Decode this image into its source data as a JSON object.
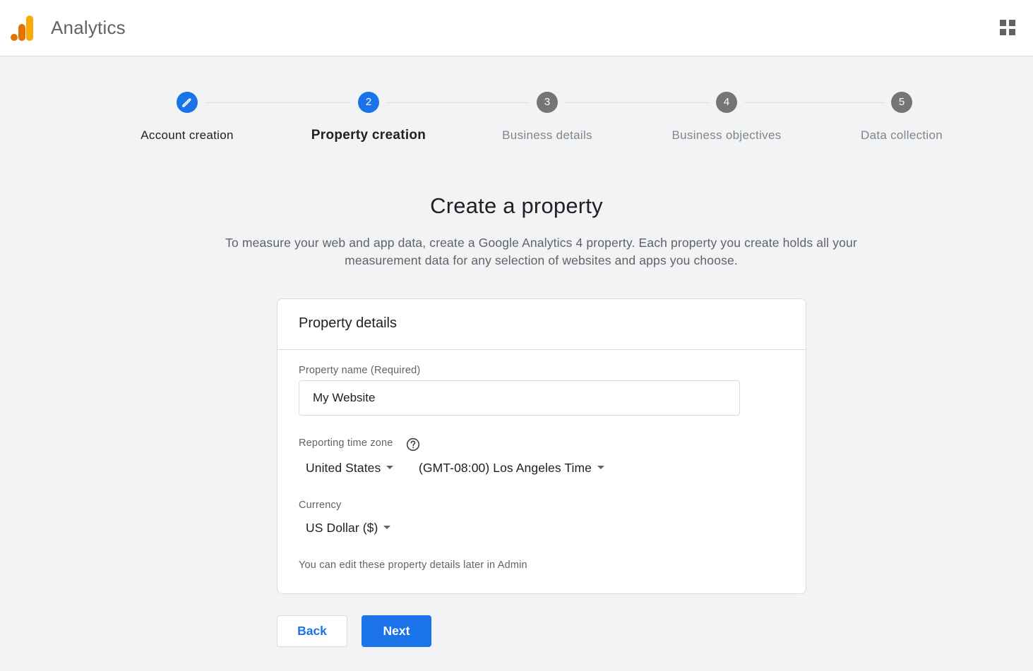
{
  "header": {
    "app_title": "Analytics",
    "logo_colors": [
      "#e37400",
      "#f9ab00"
    ],
    "apps_icon": "apps-grid-icon"
  },
  "stepper": {
    "steps": [
      {
        "number": "",
        "label": "Account creation",
        "state": "done",
        "icon": "pencil-icon"
      },
      {
        "number": "2",
        "label": "Property creation",
        "state": "active"
      },
      {
        "number": "3",
        "label": "Business details",
        "state": "pending"
      },
      {
        "number": "4",
        "label": "Business objectives",
        "state": "pending"
      },
      {
        "number": "5",
        "label": "Data collection",
        "state": "pending"
      }
    ]
  },
  "main": {
    "headline": "Create a property",
    "description": "To measure your web and app data, create a Google Analytics 4 property. Each property you create holds all your measurement data for any selection of websites and apps you choose."
  },
  "card": {
    "title": "Property details",
    "property_name_label": "Property name (Required)",
    "property_name_value": "My Website",
    "timezone_label": "Reporting time zone",
    "help_icon": "help-circle-icon",
    "country_value": "United States",
    "timezone_value": "(GMT-08:00) Los Angeles Time",
    "currency_label": "Currency",
    "currency_value": "US Dollar ($)",
    "note": "You can edit these property details later in Admin"
  },
  "actions": {
    "back_label": "Back",
    "next_label": "Next"
  },
  "colors": {
    "accent": "#1a73e8",
    "pending_step": "#757575",
    "background": "#f1f3f4"
  }
}
